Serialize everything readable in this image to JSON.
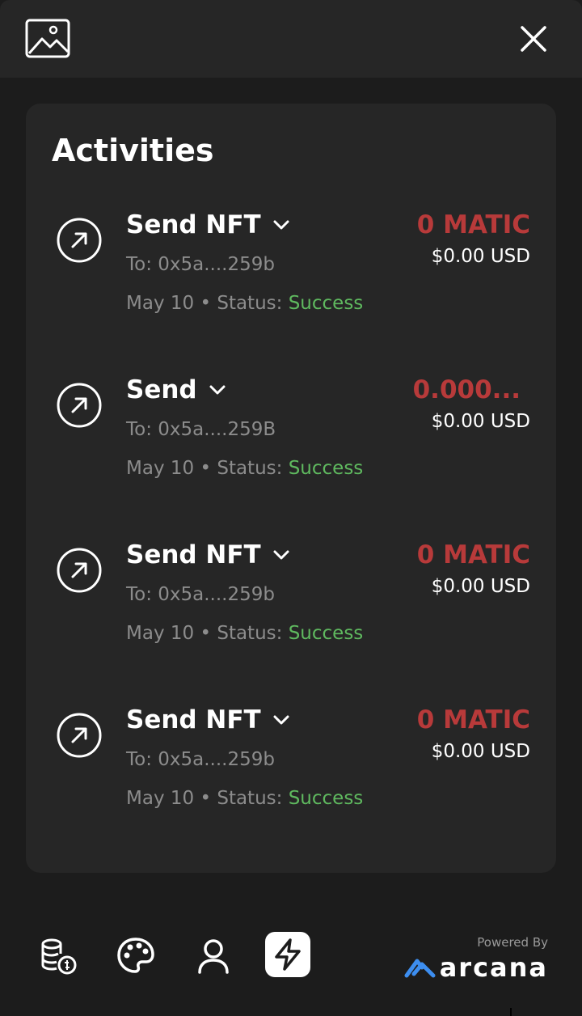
{
  "header": {
    "logo_icon": "image-icon",
    "close_icon": "close-icon"
  },
  "card": {
    "title": "Activities"
  },
  "activities": [
    {
      "title": "Send NFT",
      "to": "To: 0x5a....259b",
      "date": "May 10",
      "status_label": "Status:",
      "status": "Success",
      "amount": "0 MATIC",
      "usd": "$0.00 USD"
    },
    {
      "title": "Send",
      "to": "To: 0x5a....259B",
      "date": "May 10",
      "status_label": "Status:",
      "status": "Success",
      "amount": "0.000...",
      "usd": "$0.00 USD"
    },
    {
      "title": "Send NFT",
      "to": "To: 0x5a....259b",
      "date": "May 10",
      "status_label": "Status:",
      "status": "Success",
      "amount": "0 MATIC",
      "usd": "$0.00 USD"
    },
    {
      "title": "Send NFT",
      "to": "To: 0x5a....259b",
      "date": "May 10",
      "status_label": "Status:",
      "status": "Success",
      "amount": "0 MATIC",
      "usd": "$0.00 USD"
    }
  ],
  "nav": {
    "items": [
      {
        "icon": "tokens-icon",
        "active": false
      },
      {
        "icon": "palette-icon",
        "active": false
      },
      {
        "icon": "profile-icon",
        "active": false
      },
      {
        "icon": "lightning-icon",
        "active": true
      }
    ],
    "powered_by": "Powered By",
    "brand": "arcana"
  },
  "colors": {
    "background": "#1c1c1c",
    "surface": "#262626",
    "amount_red": "#b83a3a",
    "success_green": "#5fb95f",
    "muted_text": "#8c8c8c",
    "brand_blue": "#3d8ef0"
  }
}
